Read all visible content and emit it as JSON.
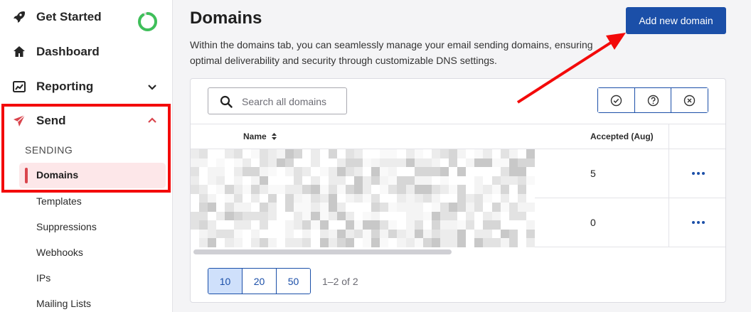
{
  "sidebar": {
    "items": [
      {
        "label": "Get Started",
        "icon": "rocket-icon"
      },
      {
        "label": "Dashboard",
        "icon": "home-icon"
      },
      {
        "label": "Reporting",
        "icon": "chart-icon"
      },
      {
        "label": "Send",
        "icon": "send-icon"
      }
    ],
    "get_started_progress": 0.9,
    "section_label": "SENDING",
    "sub_items": [
      "Domains",
      "Templates",
      "Suppressions",
      "Webhooks",
      "IPs",
      "Mailing Lists"
    ],
    "active_sub_item": "Domains"
  },
  "main": {
    "title": "Domains",
    "description": "Within the domains tab, you can seamlessly manage your email sending domains, ensuring optimal deliverability and security through customizable DNS settings.",
    "add_button_label": "Add new domain",
    "search_placeholder": "Search all domains",
    "filters": [
      "check-circle-icon",
      "help-circle-icon",
      "x-circle-icon"
    ],
    "table": {
      "columns": [
        "Name",
        "Accepted (Aug)"
      ],
      "rows": [
        {
          "name": "",
          "accepted": "5"
        },
        {
          "name": "",
          "accepted": "0"
        }
      ]
    },
    "pagination": {
      "page_sizes": [
        "10",
        "20",
        "50"
      ],
      "selected_size": "10",
      "range_text": "1–2 of 2"
    }
  },
  "colors": {
    "accent": "#1b4fa8",
    "send_red": "#d9454d",
    "highlight_red": "#f30a0a",
    "progress_green": "#3fbf5a"
  }
}
